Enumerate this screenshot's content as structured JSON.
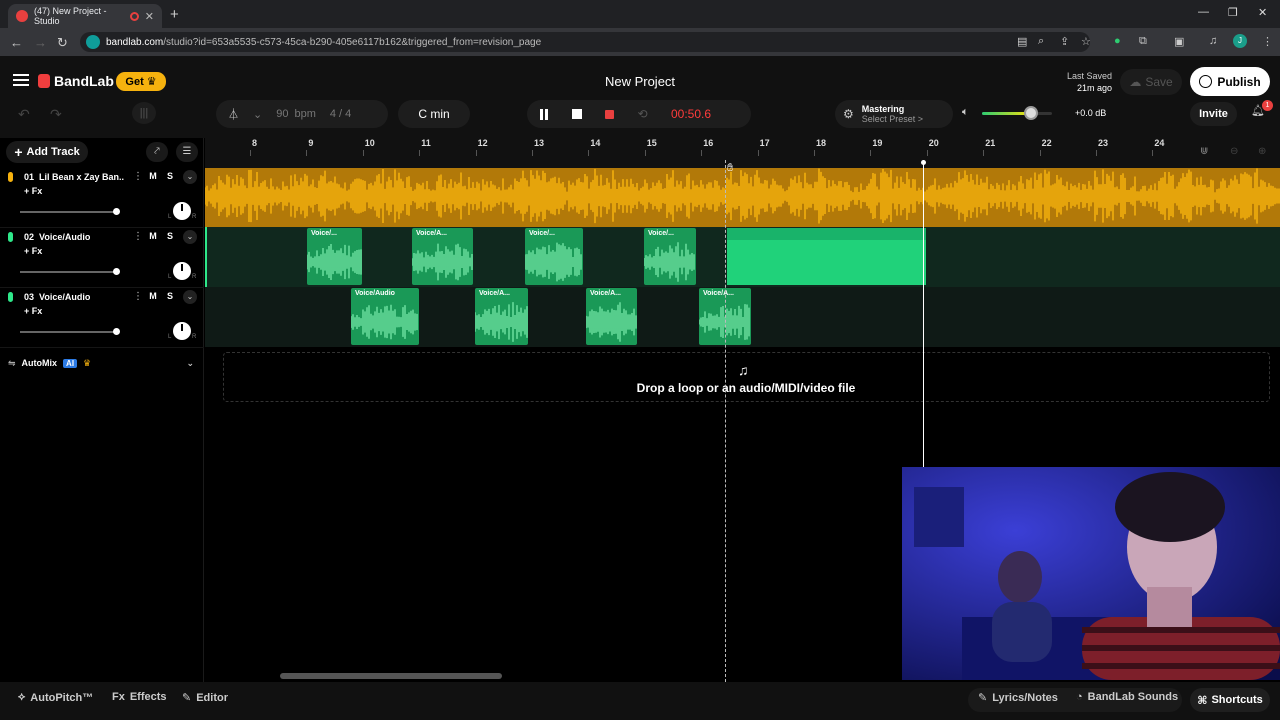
{
  "browser": {
    "tab_title": "(47) New Project - Studio",
    "new_tab": "+",
    "url_host": "bandlab.com",
    "url_path": "/studio?id=653a5535-c573-45ca-b290-405e6117b162&triggered_from=revision_page",
    "profile_initial": "J"
  },
  "app": {
    "logo": "BandLab",
    "get_label": "Get",
    "project_title": "New Project",
    "last_saved_label": "Last Saved",
    "last_saved_time": "21m ago",
    "save_label": "Save",
    "publish_label": "Publish",
    "invite_label": "Invite",
    "notification_count": "1"
  },
  "toolbar": {
    "tempo": "90",
    "tempo_unit": "bpm",
    "time_signature": "4 / 4",
    "key": "C min",
    "time": "00:50.6",
    "mastering_title": "Mastering",
    "mastering_preset": "Select Preset >",
    "volume_level": 0.7,
    "gain": "+0.0 dB"
  },
  "tracks_panel": {
    "add_track_label": "Add Track",
    "tracks": [
      {
        "num": "01",
        "name": "Lil Bean x Zay Ban...",
        "fx": "+ Fx",
        "m": "M",
        "s": "S",
        "color": "#f6b20e"
      },
      {
        "num": "02",
        "name": "Voice/Audio",
        "fx": "+ Fx",
        "m": "M",
        "s": "S",
        "color": "#2ee88a"
      },
      {
        "num": "03",
        "name": "Voice/Audio",
        "fx": "+ Fx",
        "m": "M",
        "s": "S",
        "color": "#2ee88a"
      }
    ],
    "automix_label": "AutoMix",
    "automix_ai": "AI",
    "pan_left": "L",
    "pan_right": "R"
  },
  "ruler": {
    "bars": [
      "8",
      "9",
      "10",
      "11",
      "12",
      "13",
      "14",
      "15",
      "16",
      "17",
      "18",
      "19",
      "20",
      "21",
      "22",
      "23",
      "24"
    ]
  },
  "clips": {
    "track2": [
      "Voice/...",
      "Voice/A...",
      "Voice/...",
      "Voice/..."
    ],
    "track3": [
      "Voice/Audio",
      "Voice/A...",
      "Voice/A...",
      "Voice/A..."
    ]
  },
  "drop_text": "Drop a loop or an audio/MIDI/video file",
  "bottom": {
    "autopitch": "AutoPitch™",
    "effects": "Effects",
    "editor": "Editor",
    "lyrics": "Lyrics/Notes",
    "sounds": "BandLab Sounds",
    "shortcuts": "Shortcuts"
  }
}
